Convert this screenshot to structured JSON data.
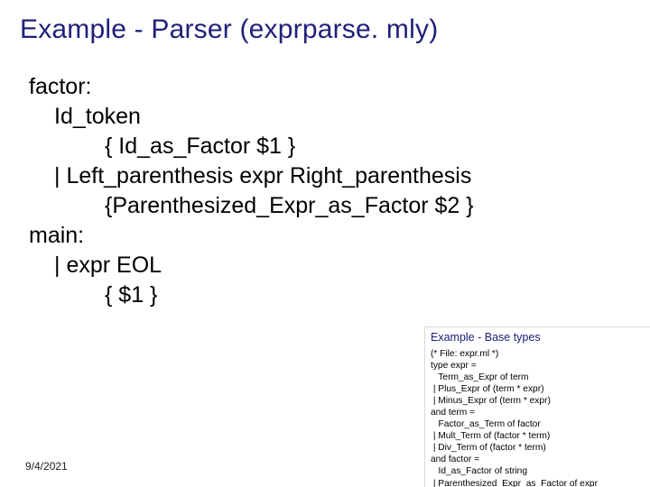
{
  "title": "Example - Parser (exprparse. mly)",
  "lines": {
    "l1": "factor:",
    "l2": "Id_token",
    "l3": "{ Id_as_Factor $1 }",
    "l4": "| Left_parenthesis expr Right_parenthesis",
    "l5": "{Parenthesized_Expr_as_Factor $2 }",
    "l6": "main:",
    "l7": "| expr EOL",
    "l8": "{ $1 }"
  },
  "footer": {
    "date": "9/4/2021"
  },
  "thumb": {
    "title": "Example - Base types",
    "body": "(* File: expr.ml *)\ntype expr =\n   Term_as_Expr of term\n | Plus_Expr of (term * expr)\n | Minus_Expr of (term * expr)\nand term =\n   Factor_as_Term of factor\n | Mult_Term of (factor * term)\n | Div_Term of (factor * term)\nand factor =\n   Id_as_Factor of string\n | Parenthesized_Expr_as_Factor of expr"
  }
}
